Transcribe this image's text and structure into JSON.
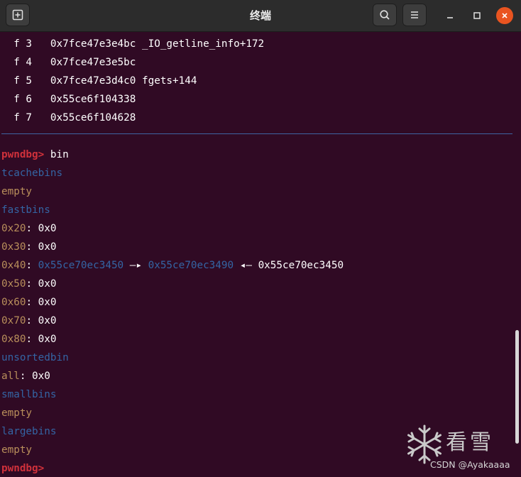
{
  "window": {
    "title": "终端"
  },
  "frames": [
    {
      "label": "f 3",
      "addr": "0x7fce47e3e4bc",
      "sym": "_IO_getline_info+172"
    },
    {
      "label": "f 4",
      "addr": "0x7fce47e3e5bc",
      "sym": ""
    },
    {
      "label": "f 5",
      "addr": "0x7fce47e3d4c0",
      "sym": "fgets+144"
    },
    {
      "label": "f 6",
      "addr": "0x55ce6f104338",
      "sym": ""
    },
    {
      "label": "f 7",
      "addr": "0x55ce6f104628",
      "sym": ""
    }
  ],
  "prompt": "pwndbg>",
  "command": "bin",
  "tcache": {
    "header": "tcachebins",
    "value": "empty"
  },
  "fastbins": {
    "header": "fastbins",
    "rows": [
      {
        "size": "0x20",
        "value": "0x0"
      },
      {
        "size": "0x30",
        "value": "0x0"
      },
      {
        "size": "0x40",
        "value": "0x55ce70ec3450",
        "arrow1": "—▸",
        "next": "0x55ce70ec3490",
        "arrow2": "◂—",
        "tail": "0x55ce70ec3450"
      },
      {
        "size": "0x50",
        "value": "0x0"
      },
      {
        "size": "0x60",
        "value": "0x0"
      },
      {
        "size": "0x70",
        "value": "0x0"
      },
      {
        "size": "0x80",
        "value": "0x0"
      }
    ]
  },
  "unsorted": {
    "header": "unsortedbin",
    "label": "all",
    "value": "0x0"
  },
  "smallbins": {
    "header": "smallbins",
    "value": "empty"
  },
  "largebins": {
    "header": "largebins",
    "value": "empty"
  },
  "last_prompt": "pwndbg>",
  "watermark": {
    "text": "看雪",
    "credit": "CSDN @Ayakaaaa"
  },
  "colors": {
    "background": "#300a24",
    "prompt": "#d0313b",
    "header": "#3465a4",
    "size": "#b98f5b",
    "close": "#e95420"
  }
}
